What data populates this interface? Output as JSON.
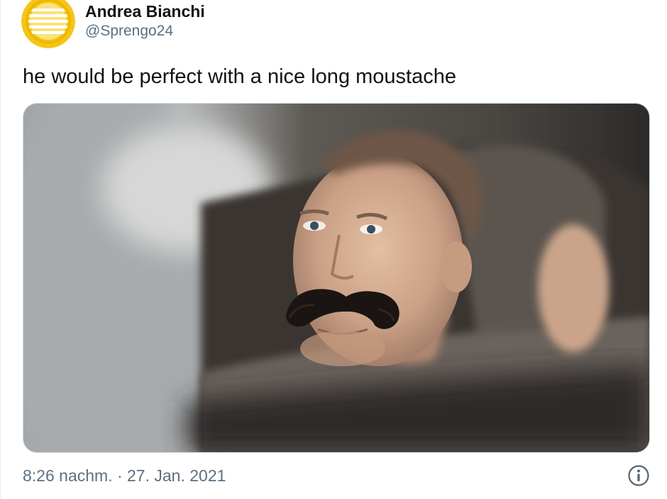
{
  "author": {
    "display_name": "Andrea Bianchi",
    "handle": "@Sprengo24",
    "avatar_icon": "sun-logo-avatar",
    "avatar_color": "#f5c518"
  },
  "tweet": {
    "text": "he would be perfect with a nice long moustache"
  },
  "media": {
    "type": "photo"
  },
  "footer": {
    "timestamp": "8:26 nachm. · 27. Jan. 2021",
    "info_icon": "info-icon"
  },
  "colors": {
    "text_primary": "#0f1419",
    "text_secondary": "#5b7083",
    "border": "#cfd9de"
  }
}
